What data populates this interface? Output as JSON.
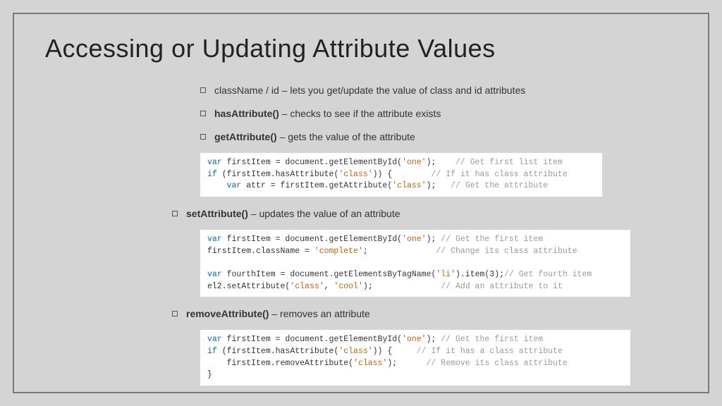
{
  "title": "Accessing or Updating Attribute Values",
  "bullets": {
    "b1_plain": "className / id – lets you get/update the value of class and id attributes",
    "b2_bold": "hasAttribute()",
    "b2_rest": " – checks to see if the attribute exists",
    "b3_bold": "getAttribute()",
    "b3_rest": " – gets the value of the attribute",
    "b4_bold": "setAttribute()",
    "b4_rest": " – updates the value of an attribute",
    "b5_bold": "removeAttribute()",
    "b5_rest": " – removes an attribute"
  },
  "code1": {
    "l1_kw": "var",
    "l1_rest": " firstItem = document.getElementById(",
    "l1_str": "'one'",
    "l1_close": ");",
    "l1_cmt": "// Get first list item",
    "l2_kw": "if",
    "l2_rest": " (firstItem.hasAttribute(",
    "l2_str": "'class'",
    "l2_close": ")) {",
    "l2_cmt": "// If it has class attribute",
    "l3_kw": "var",
    "l3_rest": " attr = firstItem.getAttribute(",
    "l3_str": "'class'",
    "l3_close": ");",
    "l3_cmt": "// Get the attribute"
  },
  "code2": {
    "l1_kw": "var",
    "l1_rest": " firstItem = document.getElementById(",
    "l1_str": "'one'",
    "l1_close": ");",
    "l1_cmt": "// Get the first item",
    "l2_rest": "firstItem.className = ",
    "l2_str": "'complete'",
    "l2_close": ";",
    "l2_cmt": "// Change its class attribute",
    "l3_kw": "var",
    "l3_rest": " fourthItem = document.getElementsByTagName(",
    "l3_str": "'li'",
    "l3_close": ").item(3);",
    "l3_cmt": "// Get fourth item",
    "l4_rest": "el2.setAttribute(",
    "l4_str1": "'class'",
    "l4_comma": ", ",
    "l4_str2": "'cool'",
    "l4_close": ");",
    "l4_cmt": "// Add an attribute to it"
  },
  "code3": {
    "l1_kw": "var",
    "l1_rest": " firstItem = document.getElementById(",
    "l1_str": "'one'",
    "l1_close": ");",
    "l1_cmt": "// Get the first item",
    "l2_kw": "if",
    "l2_rest": " (firstItem.hasAttribute(",
    "l2_str": "'class'",
    "l2_close": ")) {",
    "l2_cmt": "// If it has a class attribute",
    "l3_rest": "    firstItem.removeAttribute(",
    "l3_str": "'class'",
    "l3_close": ");",
    "l3_cmt": "// Remove its class attribute",
    "l4_rest": "}"
  }
}
